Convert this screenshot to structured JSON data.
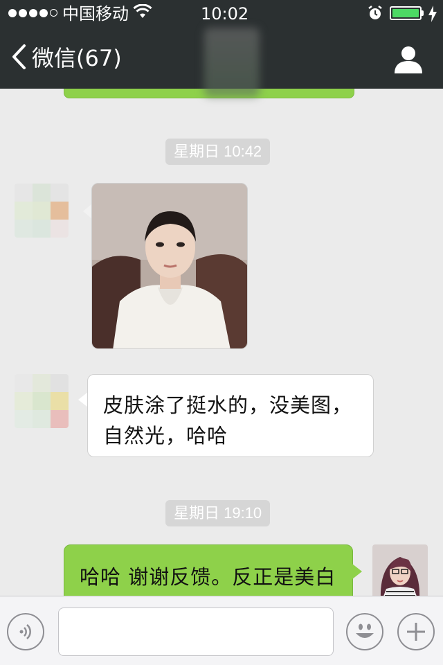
{
  "status_bar": {
    "carrier": "中国移动",
    "time": "10:02",
    "battery_level": 1.0,
    "icons": [
      "signal-icon",
      "wifi-icon",
      "alarm-icon",
      "battery-icon",
      "charging-icon"
    ]
  },
  "nav": {
    "back_label": "微信(67)",
    "icons": [
      "chevron-left-icon",
      "person-icon"
    ]
  },
  "colors": {
    "header_bg": "#2b3031",
    "chat_bg": "#ebebeb",
    "outgoing_bubble": "#8ed14a",
    "incoming_bubble": "#ffffff",
    "timestamp_bg": "#d6d6d6",
    "battery_fill": "#4cd964"
  },
  "messages": {
    "timestamp_1": "星期日 10:42",
    "incoming_text": "皮肤涂了挺水的，没美图，自然光，哈哈",
    "timestamp_2": "星期日 19:10",
    "outgoing_text": "哈哈 谢谢反馈。反正是美白 哈哈"
  },
  "input_bar": {
    "value": "",
    "icons": [
      "voice-icon",
      "emoji-icon",
      "plus-icon"
    ]
  }
}
